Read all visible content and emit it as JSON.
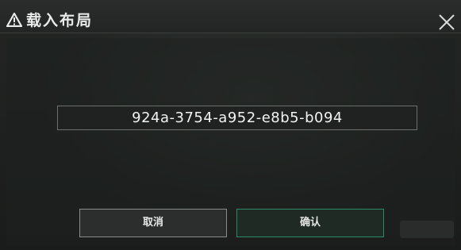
{
  "dialog": {
    "title": "载入布局",
    "icon": "warning-triangle-icon",
    "close_icon": "close-icon"
  },
  "layout_code": {
    "value": "924a-3754-a952-e8b5-b094"
  },
  "buttons": {
    "cancel_label": "取消",
    "confirm_label": "确认"
  },
  "colors": {
    "background": "#1c1e1d",
    "title_text": "#e9ebea",
    "confirm_border": "#2c8a66",
    "cancel_border": "#888d8a"
  }
}
